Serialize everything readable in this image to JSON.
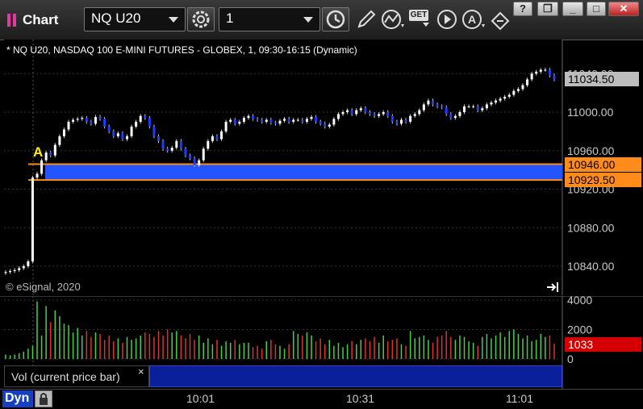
{
  "window": {
    "title": "Chart",
    "symbol": "NQ U20",
    "interval": "1",
    "buttons": {
      "minimize": "_",
      "restore": "❐",
      "maximize": "□",
      "close": "✕",
      "help": "?"
    },
    "toolbar_icons": [
      "settings-icon",
      "clock-icon",
      "pencil-icon",
      "indicator-icon",
      "get-icon",
      "play-icon",
      "alert-icon",
      "cursor-icon"
    ],
    "get_label": "GET"
  },
  "chart": {
    "title": "* NQ U20, NASDAQ 100 E-MINI FUTURES - GLOBEX, 1, 09:30-16:15 (Dynamic)",
    "copyright": "© eSignal, 2020",
    "marker_label": "A",
    "price_tags": {
      "last": "11034.50",
      "upper": "10946.00",
      "lower": "10929.50"
    },
    "colors": {
      "up": "#ffffff",
      "down": "#1a3cff",
      "band": "#2255ff",
      "band_line": "#ff8c1a",
      "vol_up": "#44d244",
      "vol_down": "#e03030",
      "last_tag": "#bdbdbd",
      "level_tag": "#ff8c1a",
      "vol_tag": "#d40000"
    }
  },
  "volume": {
    "label": "Vol (current price bar)",
    "current": "1033",
    "close": "×"
  },
  "footer": {
    "mode": "Dyn",
    "time_labels": [
      "10:01",
      "10:31",
      "11:01"
    ]
  },
  "chart_data": {
    "type": "candlestick",
    "price_axis": {
      "ticks": [
        "10840.00",
        "10880.00",
        "10920.00",
        "10960.00",
        "11000.00",
        "11040.00"
      ],
      "range": [
        10820,
        11060
      ]
    },
    "volume_axis": {
      "ticks": [
        "0",
        "2000",
        "4000"
      ],
      "range": [
        0,
        4400
      ]
    },
    "levels": [
      10946.0,
      10929.5
    ],
    "last": 11034.5,
    "close_series": [
      10834,
      10835,
      10836,
      10838,
      10840,
      10845,
      10932,
      10936,
      10950,
      10958,
      10955,
      10966,
      10975,
      10982,
      10990,
      10992,
      10993,
      10994,
      10990,
      10988,
      10995,
      10993,
      10985,
      10980,
      10975,
      10978,
      10972,
      10975,
      10985,
      10990,
      10996,
      10994,
      10985,
      10975,
      10970,
      10962,
      10960,
      10963,
      10970,
      10962,
      10955,
      10952,
      10945,
      10950,
      10962,
      10970,
      10975,
      10972,
      10980,
      10990,
      10992,
      10988,
      10990,
      10994,
      10996,
      10993,
      10992,
      10990,
      10992,
      10989,
      10988,
      10991,
      10993,
      10990,
      10992,
      10992,
      10990,
      10993,
      10995,
      10990,
      10988,
      10985,
      10987,
      10993,
      10998,
      11000,
      11002,
      10998,
      11002,
      11004,
      11000,
      10998,
      10996,
      10998,
      11000,
      10996,
      10990,
      10988,
      10992,
      10990,
      10996,
      10998,
      11002,
      11008,
      11012,
      11008,
      11006,
      11005,
      10998,
      10994,
      10996,
      11000,
      11006,
      11006,
      11006,
      11002,
      11004,
      11008,
      11010,
      11012,
      11014,
      11016,
      11018,
      11022,
      11024,
      11028,
      11034,
      11040,
      11042,
      11044,
      11044,
      11038,
      11034
    ],
    "volume_series": [
      300,
      250,
      300,
      400,
      500,
      700,
      900,
      3900,
      1600,
      3600,
      2500,
      3300,
      2900,
      2400,
      2300,
      1800,
      2100,
      1600,
      1900,
      1500,
      1800,
      1700,
      1300,
      1600,
      1200,
      1400,
      1100,
      1500,
      1300,
      1400,
      1600,
      1800,
      1700,
      1500,
      1900,
      1600,
      2000,
      1800,
      1900,
      1600,
      1400,
      1700,
      1300,
      1600,
      1100,
      1400,
      1000,
      1300,
      900,
      1200,
      1100,
      1300,
      1000,
      1100,
      1100,
      800,
      900,
      700,
      1200,
      1300,
      1000,
      900,
      700,
      1000,
      1900,
      1700,
      1600,
      1800,
      1600,
      1200,
      1400,
      1000,
      1300,
      900,
      1100,
      800,
      1000,
      1200,
      1000,
      1300,
      1400,
      1200,
      1500,
      1100,
      1600,
      1200,
      1300,
      1400,
      1000,
      900,
      1900,
      1400,
      1500,
      1600,
      1300,
      1100,
      1500,
      1600,
      1900,
      1500,
      1300,
      1600,
      1500,
      1200,
      1100,
      900,
      1500,
      1700,
      1400,
      1600,
      1800,
      1500,
      1900,
      2000,
      1700,
      1400,
      1600,
      1200,
      1300,
      1700,
      1500,
      1600,
      1033
    ]
  }
}
